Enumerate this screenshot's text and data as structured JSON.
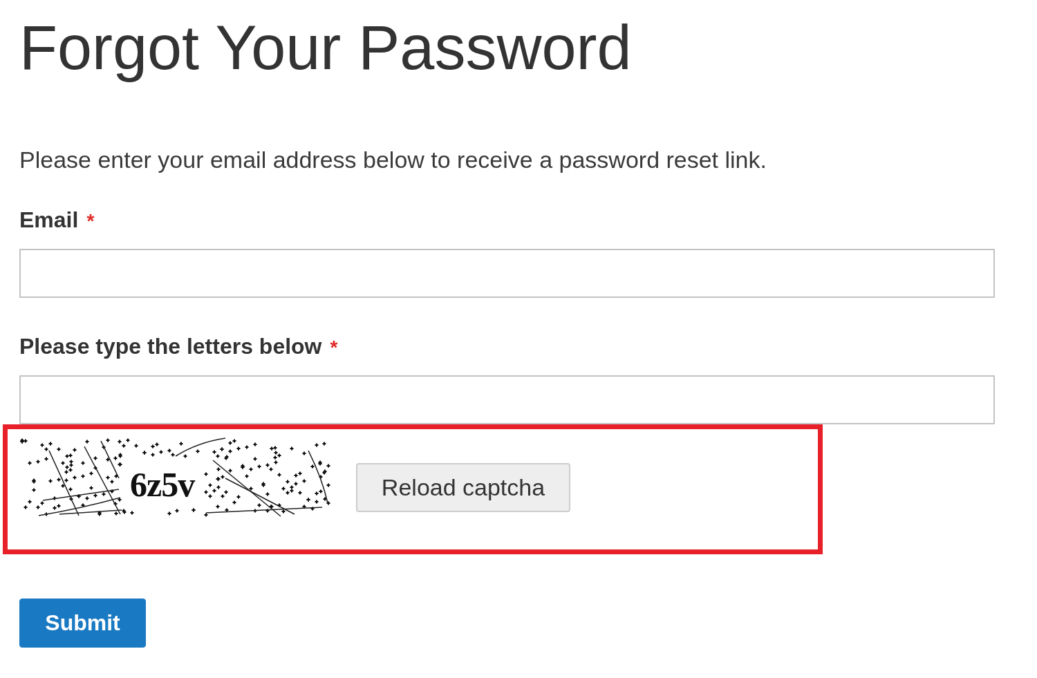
{
  "page": {
    "title": "Forgot Your Password",
    "intro": "Please enter your email address below to receive a password reset link."
  },
  "fields": [
    {
      "label": "Email",
      "required_mark": "*"
    },
    {
      "label": "Please type the letters below",
      "required_mark": "*"
    }
  ],
  "captcha": {
    "text": "6z5v",
    "highlighted": true,
    "reload_button": "Reload captcha"
  },
  "submit_button": "Submit"
}
